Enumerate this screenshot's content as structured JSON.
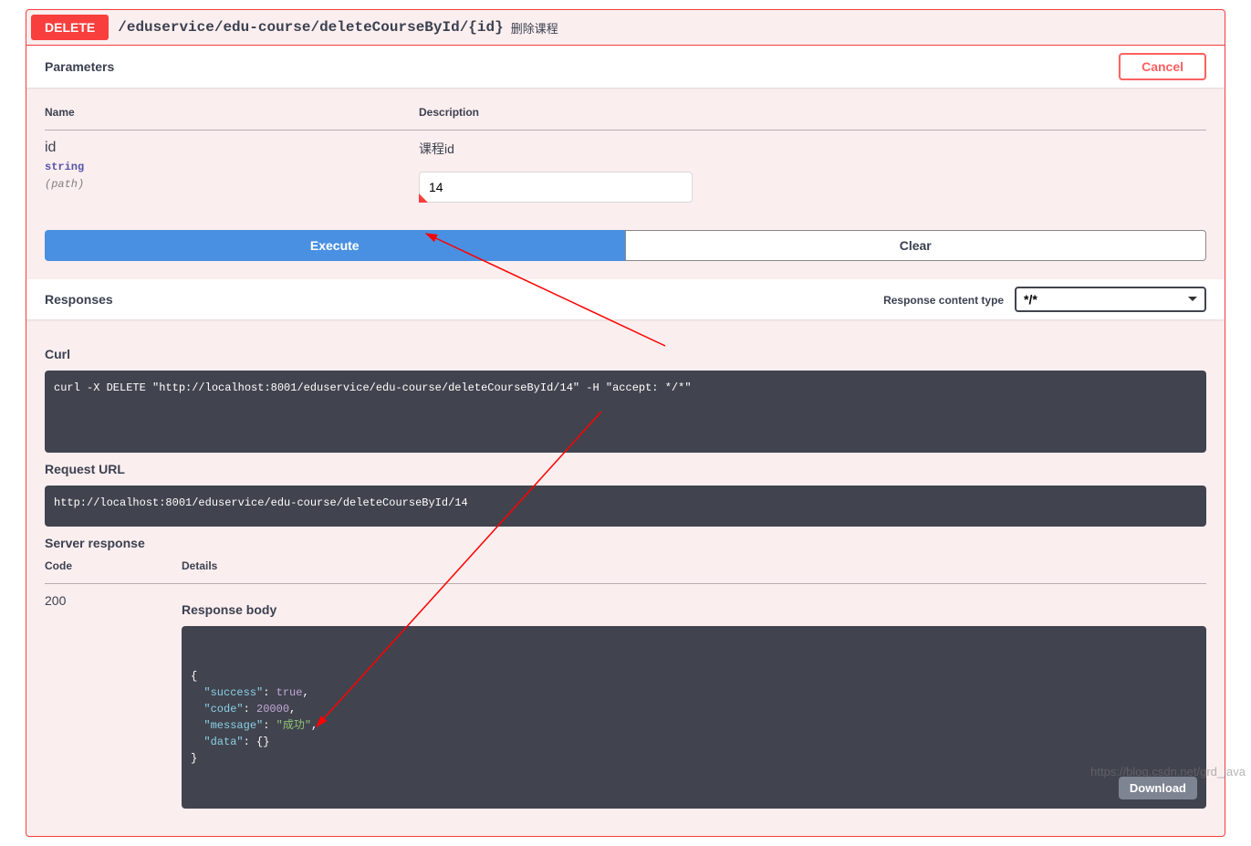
{
  "operation": {
    "method": "DELETE",
    "path": "/eduservice/edu-course/deleteCourseById/{id}",
    "summary": "删除课程"
  },
  "sections": {
    "parameters_title": "Parameters",
    "cancel_label": "Cancel",
    "name_header": "Name",
    "description_header": "Description",
    "responses_title": "Responses",
    "content_type_label": "Response content type",
    "content_type_value": "*/*",
    "curl_title": "Curl",
    "request_url_title": "Request URL",
    "server_response_title": "Server response",
    "code_header": "Code",
    "details_header": "Details",
    "response_body_title": "Response body"
  },
  "buttons": {
    "execute": "Execute",
    "clear": "Clear",
    "download": "Download"
  },
  "parameters": [
    {
      "name": "id",
      "type": "string",
      "in": "(path)",
      "description": "课程id",
      "value": "14"
    }
  ],
  "curl_command": "curl -X DELETE \"http://localhost:8001/eduservice/edu-course/deleteCourseById/14\" -H \"accept: */*\"",
  "request_url": "http://localhost:8001/eduservice/edu-course/deleteCourseById/14",
  "response": {
    "code": "200",
    "body_raw": "{\n  \"success\": true,\n  \"code\": 20000,\n  \"message\": \"成功\",\n  \"data\": {}\n}"
  },
  "watermark": "https://blog.csdn.net/grd_java"
}
